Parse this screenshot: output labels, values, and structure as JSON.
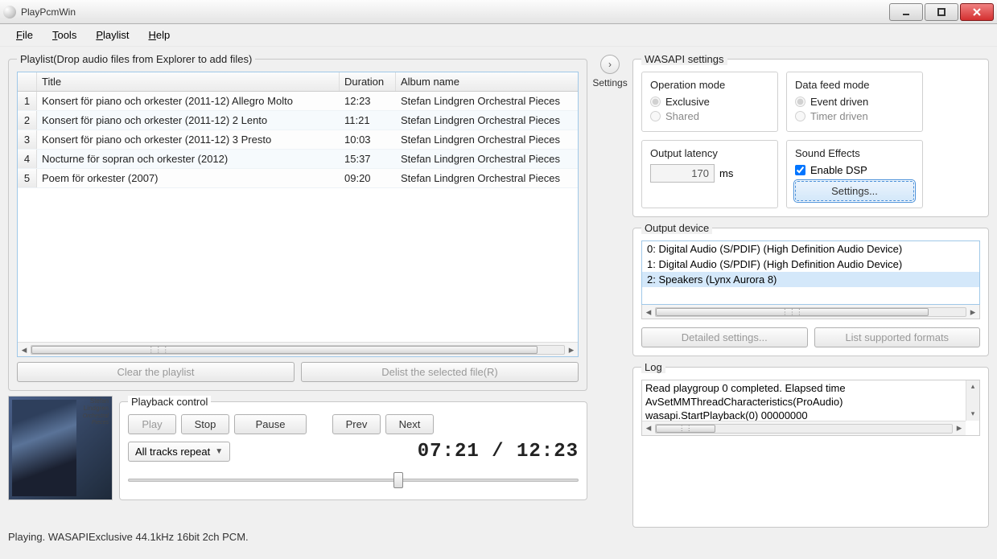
{
  "window": {
    "title": "PlayPcmWin"
  },
  "menu": {
    "file": "File",
    "tools": "Tools",
    "playlist": "Playlist",
    "help": "Help"
  },
  "playlist": {
    "title": "Playlist(Drop audio files from Explorer to add files)",
    "columns": {
      "title": "Title",
      "duration": "Duration",
      "album": "Album name"
    },
    "rows": [
      {
        "n": "1",
        "title": "Konsert för piano och orkester (2011-12) Allegro Molto",
        "dur": "12:23",
        "album": "Stefan Lindgren Orchestral Pieces"
      },
      {
        "n": "2",
        "title": "Konsert för piano och orkester (2011-12) 2 Lento",
        "dur": "11:21",
        "album": "Stefan Lindgren Orchestral Pieces"
      },
      {
        "n": "3",
        "title": "Konsert för piano och orkester (2011-12) 3 Presto",
        "dur": "10:03",
        "album": "Stefan Lindgren Orchestral Pieces"
      },
      {
        "n": "4",
        "title": "Nocturne för sopran och orkester (2012)",
        "dur": "15:37",
        "album": "Stefan Lindgren Orchestral Pieces"
      },
      {
        "n": "5",
        "title": "Poem för orkester (2007)",
        "dur": "09:20",
        "album": "Stefan Lindgren Orchestral Pieces"
      }
    ],
    "clear_btn": "Clear the playlist",
    "delist_btn": "Delist the selected file(R)"
  },
  "albumart": {
    "artist": "Stefan\nLindgren",
    "subtitle": "Orchestral\nPieces"
  },
  "playback": {
    "title": "Playback control",
    "play": "Play",
    "stop": "Stop",
    "pause": "Pause",
    "prev": "Prev",
    "next": "Next",
    "repeat": "All tracks repeat",
    "time": "07:21 / 12:23"
  },
  "settings_toggle": "Settings",
  "wasapi": {
    "title": "WASAPI settings",
    "opmode": {
      "title": "Operation mode",
      "exclusive": "Exclusive",
      "shared": "Shared"
    },
    "feed": {
      "title": "Data feed mode",
      "event": "Event driven",
      "timer": "Timer driven"
    },
    "latency": {
      "title": "Output latency",
      "value": "170",
      "unit": "ms"
    },
    "fx": {
      "title": "Sound Effects",
      "enable": "Enable DSP",
      "settings": "Settings..."
    }
  },
  "output": {
    "title": "Output device",
    "devices": [
      "0: Digital Audio (S/PDIF) (High Definition Audio Device)",
      "1: Digital Audio (S/PDIF) (High Definition Audio Device)",
      "2: Speakers (Lynx Aurora 8)"
    ],
    "detailed": "Detailed settings...",
    "list": "List supported formats"
  },
  "log": {
    "title": "Log",
    "lines": [
      "Read playgroup 0 completed. Elapsed time",
      "AvSetMMThreadCharacteristics(ProAudio) ",
      "wasapi.StartPlayback(0) 00000000"
    ]
  },
  "status": "Playing. WASAPIExclusive 44.1kHz 16bit 2ch PCM."
}
